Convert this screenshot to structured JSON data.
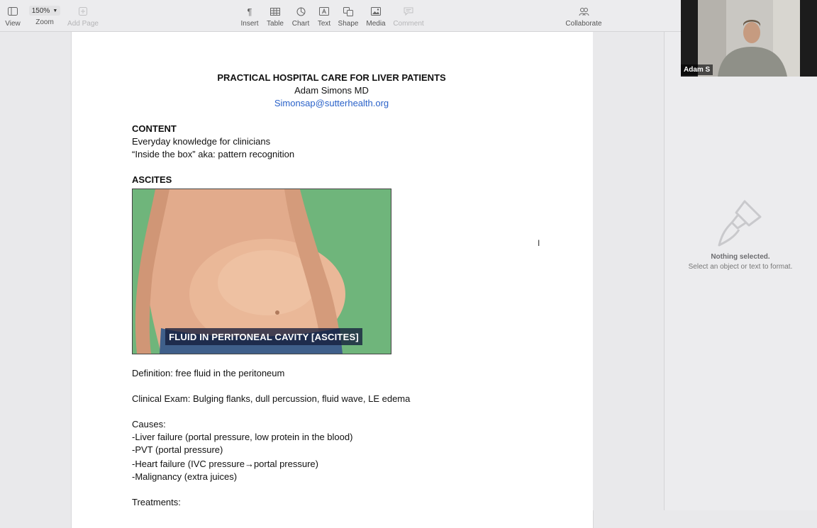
{
  "toolbar": {
    "left": [
      {
        "label": "View",
        "icon": "sidebar-icon"
      },
      {
        "label": "Zoom",
        "value": "150%",
        "icon": "chevron-down-icon"
      },
      {
        "label": "Add Page",
        "icon": "add-page-icon",
        "disabled": true
      }
    ],
    "center": [
      {
        "label": "Insert",
        "icon": "pilcrow-icon"
      },
      {
        "label": "Table",
        "icon": "table-icon"
      },
      {
        "label": "Chart",
        "icon": "chart-icon"
      },
      {
        "label": "Text",
        "icon": "text-box-icon"
      },
      {
        "label": "Shape",
        "icon": "shape-icon"
      },
      {
        "label": "Media",
        "icon": "media-icon"
      },
      {
        "label": "Comment",
        "icon": "comment-icon",
        "disabled": true
      }
    ],
    "right": [
      {
        "label": "Collaborate",
        "icon": "collaborate-icon"
      }
    ]
  },
  "document": {
    "title": "PRACTICAL HOSPITAL CARE FOR LIVER PATIENTS",
    "author": "Adam Simons MD",
    "email": "Simonsap@sutterhealth.org",
    "content_heading": "CONTENT",
    "content_lines": [
      "Everyday knowledge for clinicians",
      "“Inside the box” aka: pattern recognition"
    ],
    "ascites_heading": "ASCITES",
    "image_caption": "FLUID IN PERITONEAL CAVITY [ASCITES]",
    "definition": "Definition: free fluid in the peritoneum",
    "clinical_exam": "Clinical Exam: Bulging flanks, dull percussion, fluid wave, LE edema",
    "causes_heading": "Causes:",
    "causes": [
      "-Liver failure (portal pressure, low protein in the blood)",
      "-PVT (portal pressure)",
      "-Heart failure (IVC pressure→portal pressure)",
      "-Malignancy (extra juices)"
    ],
    "treatments_heading": "Treatments:"
  },
  "inspector": {
    "title": "Nothing selected.",
    "subtitle": "Select an object or text to format.",
    "icon": "paintbrush-icon"
  },
  "video": {
    "participant_name": "Adam S"
  }
}
